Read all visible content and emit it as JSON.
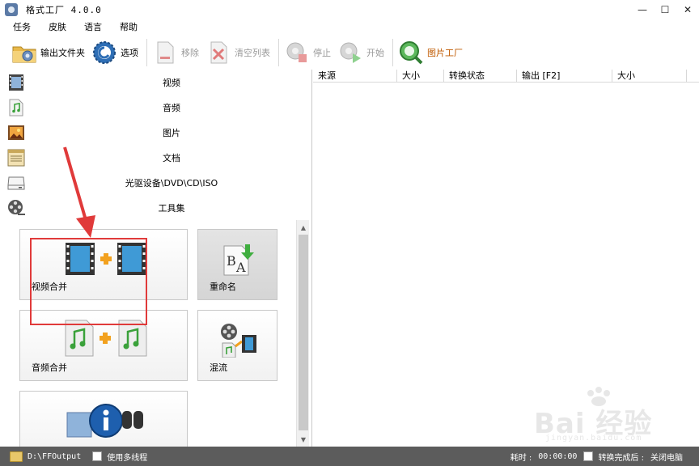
{
  "window": {
    "title": "格式工厂 4.0.0",
    "controls": {
      "minimize": "—",
      "maximize": "☐",
      "close": "✕"
    }
  },
  "menu": [
    "任务",
    "皮肤",
    "语言",
    "帮助"
  ],
  "toolbar": {
    "output_folder": "输出文件夹",
    "options": "选项",
    "remove": "移除",
    "clear_list": "清空列表",
    "stop": "停止",
    "start": "开始",
    "picture_factory": "图片工厂"
  },
  "categories": [
    "视频",
    "音频",
    "图片",
    "文档",
    "光驱设备\\DVD\\CD\\ISO",
    "工具集"
  ],
  "tools": {
    "video_merge": "视频合并",
    "rename": "重命名",
    "audio_merge": "音频合并",
    "mux": "混流"
  },
  "list": {
    "columns": [
      "来源",
      "大小",
      "转换状态",
      "输出 [F2]",
      "大小"
    ]
  },
  "status": {
    "output_path": "D:\\FFOutput",
    "multithread": "使用多线程",
    "elapsed_label": "耗时 :",
    "elapsed_value": "00:00:00",
    "after_done": "转换完成后 :",
    "after_action": "关闭电脑"
  },
  "watermark": {
    "brand": "Bai 经验",
    "url": "jingyan.baidu.com"
  },
  "colors": {
    "highlight": "#e03a3a",
    "statusbar": "#5c5c5c",
    "accent": "#c05a00"
  }
}
